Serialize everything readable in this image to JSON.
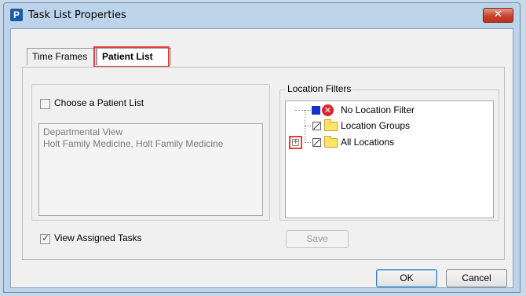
{
  "window": {
    "app_icon_letter": "P",
    "title": "Task List Properties",
    "close_glyph": "✕"
  },
  "tabs": [
    {
      "label": "Time Frames"
    },
    {
      "label": "Patient List",
      "selected": true
    }
  ],
  "patient_list": {
    "choose_label": "Choose a Patient List",
    "choose_checked": false,
    "lines": [
      "Departmental View",
      "Holt Family Medicine, Holt Family Medicine"
    ]
  },
  "location_filters": {
    "title": "Location Filters",
    "items": [
      {
        "label": "No Location Filter",
        "icon": "no-entry-icon"
      },
      {
        "label": "Location Groups",
        "icon": "folder-icon"
      },
      {
        "label": "All Locations",
        "icon": "folder-icon",
        "expander": "+"
      }
    ]
  },
  "view_assigned": {
    "label": "View Assigned Tasks",
    "checked": true
  },
  "buttons": {
    "save": "Save",
    "ok": "OK",
    "cancel": "Cancel"
  },
  "colors": {
    "highlight": "#e0403e",
    "titlebar": "#bcd3ea",
    "close": "#c7432c"
  }
}
